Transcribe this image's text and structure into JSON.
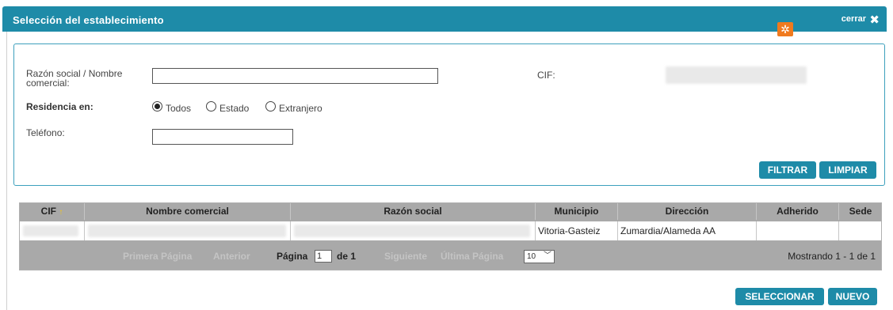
{
  "dialog": {
    "title": "Selección del establecimiento",
    "close_label": "cerrar",
    "close_icon": "✖"
  },
  "filters": {
    "razon_label": "Razón social / Nombre comercial:",
    "razon_value": "",
    "cif_label": "CIF:",
    "residencia_label": "Residencia en:",
    "residencia_options": [
      "Todos",
      "Estado",
      "Extranjero"
    ],
    "residencia_selected": "Todos",
    "telefono_label": "Teléfono:",
    "telefono_value": "",
    "filtrar_label": "FILTRAR",
    "limpiar_label": "LIMPIAR"
  },
  "grid": {
    "columns": [
      "CIF",
      "Nombre comercial",
      "Razón social",
      "Municipio",
      "Dirección",
      "Adherido",
      "Sede"
    ],
    "sort_icon": "↑",
    "rows": [
      {
        "cif": "",
        "nombre_comercial": "",
        "razon_social": "",
        "municipio": "Vitoria-Gasteiz",
        "direccion": "Zumardia/Alameda  AA",
        "adherido_icon": "adherido-icon",
        "sede": ""
      }
    ],
    "pager": {
      "first": "Primera Página",
      "prev": "Anterior",
      "page_label": "Página",
      "page_value": "1",
      "of_label": "de 1",
      "next": "Siguiente",
      "last": "Última Página",
      "page_size": "10",
      "showing": "Mostrando 1 - 1 de 1"
    }
  },
  "footer": {
    "seleccionar_label": "SELECCIONAR",
    "nuevo_label": "NUEVO"
  },
  "colors": {
    "accent": "#1e8ba8",
    "adherido": "#f07a1e",
    "grid_header": "#a9a9a9"
  }
}
